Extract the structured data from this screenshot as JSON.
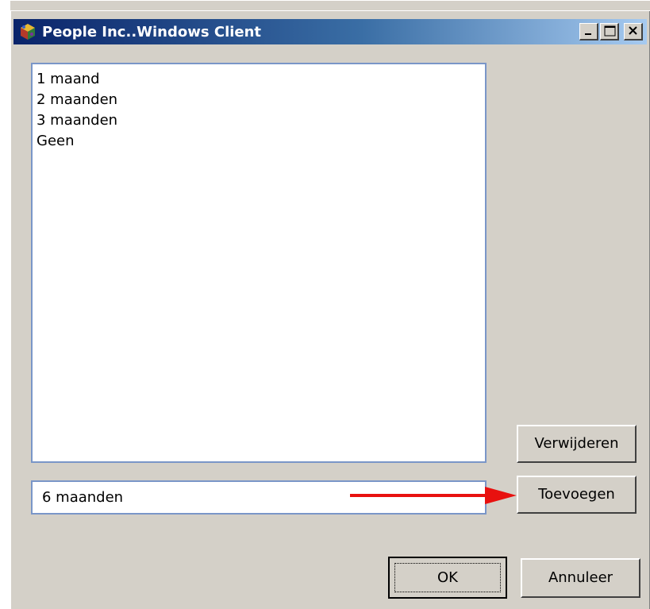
{
  "window": {
    "title": "People Inc..Windows Client",
    "caption_buttons": {
      "minimize_icon": "minimize-icon",
      "maximize_icon": "maximize-icon",
      "close_icon": "close-icon"
    },
    "app_icon": "app-cube-icon",
    "colors": {
      "face": "#d4d0c8",
      "titlebar_start": "#0a246a",
      "titlebar_end": "#a6caf0",
      "field_border": "#7a96c8",
      "annotation_arrow": "#e8110f"
    }
  },
  "list": {
    "items": [
      "1 maand",
      "2 maanden",
      "3 maanden",
      "Geen"
    ]
  },
  "input": {
    "value": "6 maanden"
  },
  "buttons": {
    "remove": "Verwijderen",
    "add": "Toevoegen",
    "ok": "OK",
    "cancel": "Annuleer"
  },
  "annotation": {
    "icon": "red-arrow-icon"
  }
}
